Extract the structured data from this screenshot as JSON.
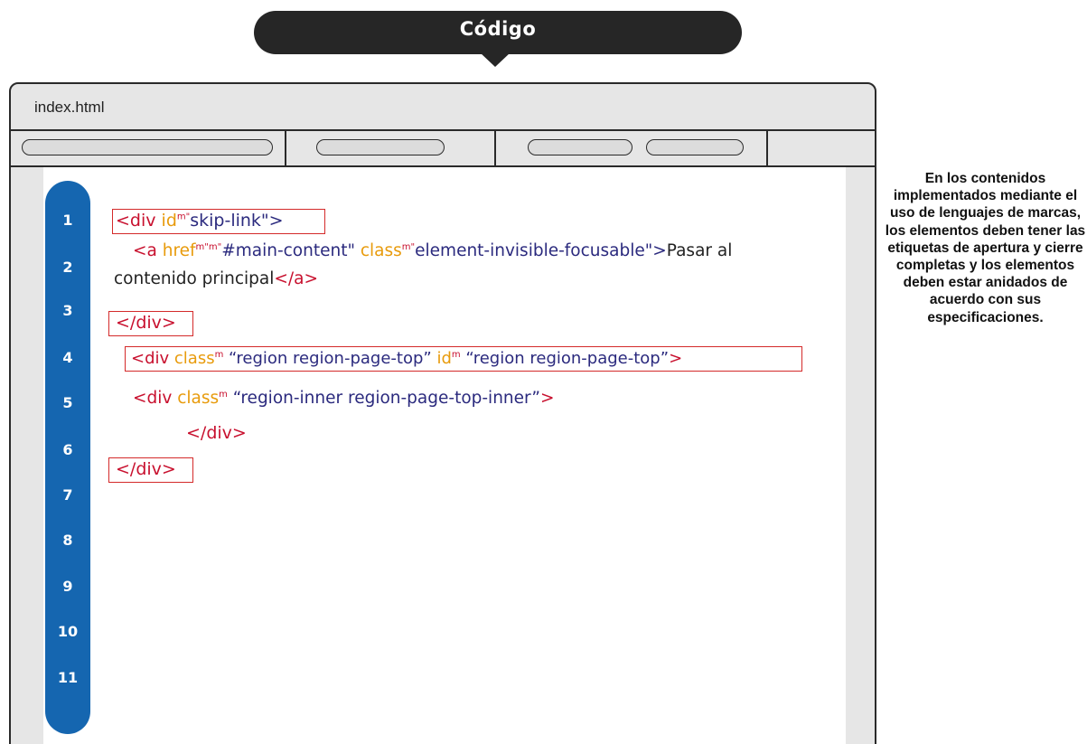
{
  "header": {
    "title": "Código"
  },
  "window": {
    "file_title": "index.html"
  },
  "editor": {
    "line_numbers": [
      "1",
      "2",
      "3",
      "4",
      "5",
      "6",
      "7",
      "8",
      "9",
      "10",
      "11"
    ],
    "line1": {
      "open": "<div ",
      "attr": "id",
      "mark": "m\"",
      "value": "skip-link\">"
    },
    "line2": {
      "open": "<a ",
      "attr1": "href",
      "mark1": "m\"m\"",
      "value1": "#main-content\" ",
      "attr2": "class",
      "mark2": "m\"",
      "value2": "element-invisible-focusable\">",
      "text": "Pasar al",
      "text_cont": "contenido principal",
      "close": "</a>"
    },
    "line3": {
      "close": "</div>"
    },
    "line4": {
      "open": "<div ",
      "attr1": "class",
      "mark1": "m",
      "value1": " “region region-page-top” ",
      "attr2": "id",
      "mark2": "m",
      "value2": " “region region-page-top”",
      "end": ">"
    },
    "line5": {
      "open": "<div ",
      "attr1": "class",
      "mark1": "m",
      "value1": " “region-inner region-page-top-inner”",
      "end": ">"
    },
    "line6": {
      "close": "</div>"
    },
    "line7": {
      "close": "</div>"
    }
  },
  "note": {
    "text": "En los contenidos implementados mediante el uso de lenguajes de marcas, los elementos deben tener las etiquetas de apertura y cierre completas y los elementos deben estar anidados de acuerdo con sus especificaciones."
  },
  "colors": {
    "pill": "#262626",
    "gutter": "#1566b0",
    "tag": "#c8102e",
    "attribute": "#e89b0c",
    "string": "#2b2a7e",
    "highlight_box": "#d42a2a"
  }
}
